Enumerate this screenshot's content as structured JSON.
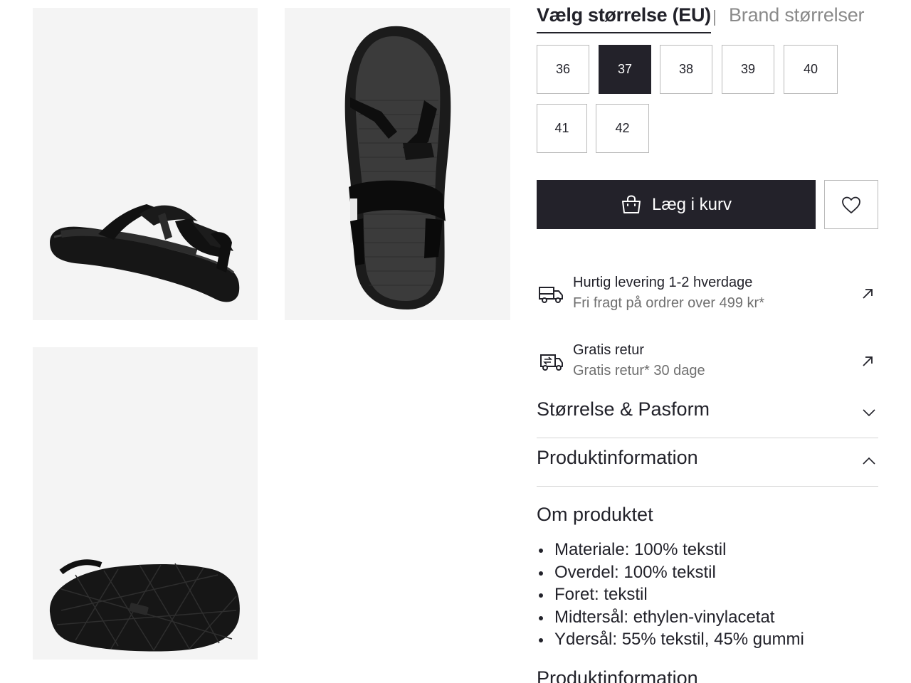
{
  "gallery": {
    "images": [
      {
        "alt": "",
        "view": "side"
      },
      {
        "alt": "",
        "view": "top"
      },
      {
        "alt": "",
        "view": "sole"
      }
    ]
  },
  "size_selector": {
    "tab_active": "Vælg størrelse (EU)",
    "tab_inactive": "Brand størrelser",
    "sizes": [
      "36",
      "37",
      "38",
      "39",
      "40",
      "41",
      "42"
    ],
    "selected": "37"
  },
  "actions": {
    "add_to_cart": "Læg i kurv",
    "cart_icon": "shopping-bag-icon",
    "wishlist_icon": "heart-icon"
  },
  "delivery": {
    "title": "Hurtig levering 1-2 hverdage",
    "subtitle": "Fri fragt på ordrer over 499 kr*",
    "icon": "truck-icon"
  },
  "returns": {
    "title": "Gratis retur",
    "subtitle": "Gratis retur* 30 dage",
    "icon": "return-truck-icon"
  },
  "accordions": [
    {
      "title": "Størrelse & Pasform",
      "expanded": false
    },
    {
      "title": "Produktinformation",
      "expanded": true
    }
  ],
  "about": {
    "title": "Om produktet",
    "items": [
      "Materiale: 100% tekstil",
      "Overdel: 100% tekstil",
      "Foret: tekstil",
      "Midtersål: ethylen-vinylacetat",
      "Ydersål: 55% tekstil, 45% gummi"
    ],
    "next_heading": "Produktinformation"
  },
  "colors": {
    "primary": "#23222a",
    "image_bg": "#f4f4f4",
    "muted_text": "#6f6f6f",
    "border": "#b9b9b9"
  }
}
